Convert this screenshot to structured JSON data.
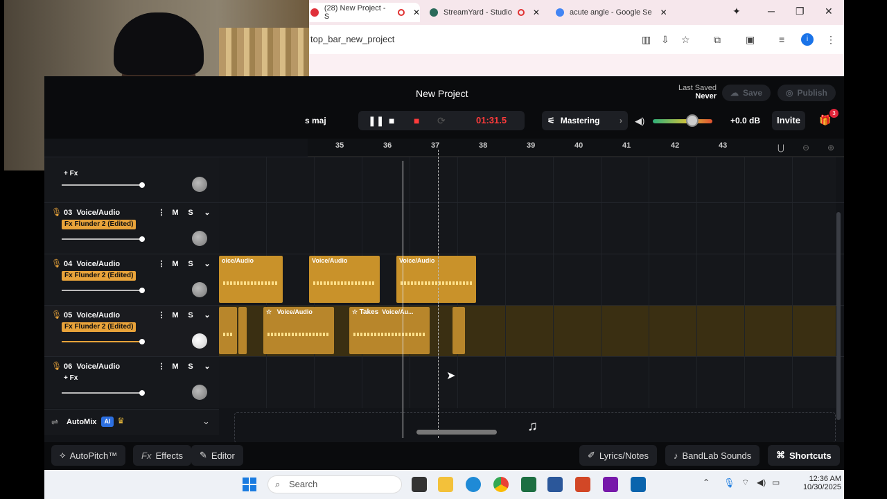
{
  "browser": {
    "tabs": [
      {
        "label": "(28) New Project - S"
      },
      {
        "label": "StreamYard - Studio"
      },
      {
        "label": "acute angle - Google Se"
      }
    ],
    "url": "top_bar_new_project",
    "profile_initial": "i"
  },
  "daw": {
    "project_title": "New Project",
    "last_saved_label": "Last Saved",
    "last_saved_value": "Never",
    "save_label": "Save",
    "publish_label": "Publish",
    "key_label": "s maj",
    "timecode": "01:31.5",
    "mastering_label": "Mastering",
    "volume_db": "+0.0 dB",
    "invite_label": "Invite",
    "gift_count": "3",
    "ruler_ticks": [
      "35",
      "36",
      "37",
      "38",
      "39",
      "40",
      "41",
      "42",
      "43"
    ],
    "tracks": [
      {
        "number": "03",
        "name": "Voice/Audio",
        "fx": "Fx Flunder 2 (Edited)"
      },
      {
        "number": "04",
        "name": "Voice/Audio",
        "fx": "Fx Flunder 2 (Edited)"
      },
      {
        "number": "05",
        "name": "Voice/Audio",
        "fx": "Fx Flunder 2 (Edited)"
      },
      {
        "number": "06",
        "name": "Voice/Audio",
        "fx": "+ Fx"
      }
    ],
    "top_track_fx": "+ Fx",
    "mute_label": "M",
    "solo_label": "S",
    "clips": {
      "t4_a": "oice/Audio",
      "t4_b": "Voice/Audio",
      "t4_c": "Voice/Audio",
      "t5_a": "Voice/Audio",
      "t5_b_takes": "Takes",
      "t5_b": "Voice/Au..."
    },
    "automix_label": "AutoMix",
    "ai_badge": "AI",
    "bottom": {
      "autopitch": "AutoPitch™",
      "effects": "Effects",
      "editor": "Editor",
      "lyrics": "Lyrics/Notes",
      "sounds": "BandLab Sounds",
      "shortcuts": "Shortcuts"
    }
  },
  "taskbar": {
    "search_placeholder": "Search",
    "time": "12:36 AM",
    "date": "10/30/2025"
  }
}
